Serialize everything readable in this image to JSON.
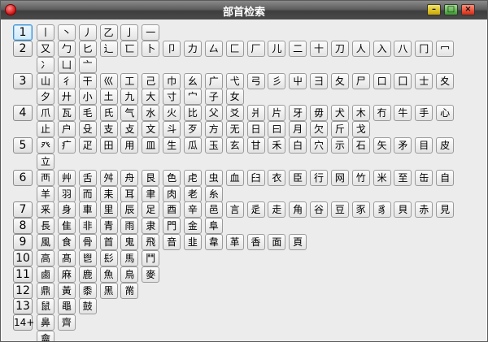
{
  "window": {
    "title": "部首检索"
  },
  "rows": [
    {
      "label": "1",
      "selected": true,
      "radicals": [
        "丨",
        "丶",
        "丿",
        "乙",
        "亅",
        "一"
      ]
    },
    {
      "label": "2",
      "radicals": [
        "又",
        "勹",
        "匕",
        "⻌",
        "匸",
        "卜",
        "卩",
        "力",
        "厶",
        "匚",
        "厂",
        "儿",
        "二",
        "十",
        "刀",
        "人",
        "入",
        "八",
        "冂",
        "冖"
      ]
    },
    {
      "label": "",
      "radicals": [
        "冫",
        "凵",
        "亠"
      ]
    },
    {
      "label": "3",
      "radicals": [
        "山",
        "彳",
        "干",
        "巛",
        "工",
        "己",
        "巾",
        "幺",
        "广",
        "弋",
        "弓",
        "彡",
        "屮",
        "彐",
        "夂",
        "尸",
        "口",
        "囗",
        "士",
        "夊"
      ]
    },
    {
      "label": "",
      "radicals": [
        "夕",
        "廾",
        "小",
        "土",
        "九",
        "大",
        "寸",
        "宀",
        "子",
        "女"
      ]
    },
    {
      "label": "4",
      "radicals": [
        "爪",
        "瓦",
        "毛",
        "氏",
        "气",
        "水",
        "火",
        "比",
        "父",
        "爻",
        "爿",
        "片",
        "牙",
        "毋",
        "犬",
        "木",
        "冇",
        "牛",
        "手",
        "心"
      ]
    },
    {
      "label": "",
      "radicals": [
        "止",
        "户",
        "殳",
        "支",
        "攴",
        "文",
        "斗",
        "歹",
        "方",
        "无",
        "日",
        "曰",
        "月",
        "欠",
        "斤",
        "戈"
      ]
    },
    {
      "label": "5",
      "radicals": [
        "癶",
        "疒",
        "疋",
        "田",
        "用",
        "皿",
        "生",
        "瓜",
        "玉",
        "玄",
        "甘",
        "禾",
        "白",
        "穴",
        "示",
        "石",
        "矢",
        "矛",
        "目",
        "皮"
      ]
    },
    {
      "label": "",
      "radicals": [
        "立"
      ]
    },
    {
      "label": "6",
      "radicals": [
        "襾",
        "艸",
        "舌",
        "舛",
        "舟",
        "艮",
        "色",
        "虍",
        "虫",
        "血",
        "臼",
        "衣",
        "臣",
        "行",
        "网",
        "竹",
        "米",
        "至",
        "缶",
        "自"
      ]
    },
    {
      "label": "",
      "radicals": [
        "羊",
        "羽",
        "而",
        "耒",
        "耳",
        "聿",
        "肉",
        "老",
        "糸"
      ]
    },
    {
      "label": "7",
      "radicals": [
        "釆",
        "身",
        "車",
        "里",
        "辰",
        "足",
        "酉",
        "辛",
        "邑",
        "言",
        "辵",
        "走",
        "角",
        "谷",
        "豆",
        "豕",
        "豸",
        "貝",
        "赤",
        "見"
      ]
    },
    {
      "label": "8",
      "radicals": [
        "長",
        "隹",
        "非",
        "青",
        "雨",
        "隶",
        "門",
        "金",
        "阜"
      ]
    },
    {
      "label": "9",
      "radicals": [
        "風",
        "食",
        "骨",
        "首",
        "鬼",
        "飛",
        "音",
        "韭",
        "韋",
        "革",
        "香",
        "面",
        "頁"
      ]
    },
    {
      "label": "10",
      "radicals": [
        "高",
        "髙",
        "鬯",
        "髟",
        "馬",
        "鬥"
      ]
    },
    {
      "label": "11",
      "radicals": [
        "鹵",
        "麻",
        "鹿",
        "魚",
        "鳥",
        "麥"
      ]
    },
    {
      "label": "12",
      "radicals": [
        "鼎",
        "黃",
        "黍",
        "黑",
        "黹"
      ]
    },
    {
      "label": "13",
      "radicals": [
        "鼠",
        "黽",
        "鼓"
      ]
    },
    {
      "label": "14+",
      "radicals": [
        "鼻",
        "齊"
      ]
    },
    {
      "label": "",
      "radicals": [
        "龠"
      ]
    }
  ]
}
